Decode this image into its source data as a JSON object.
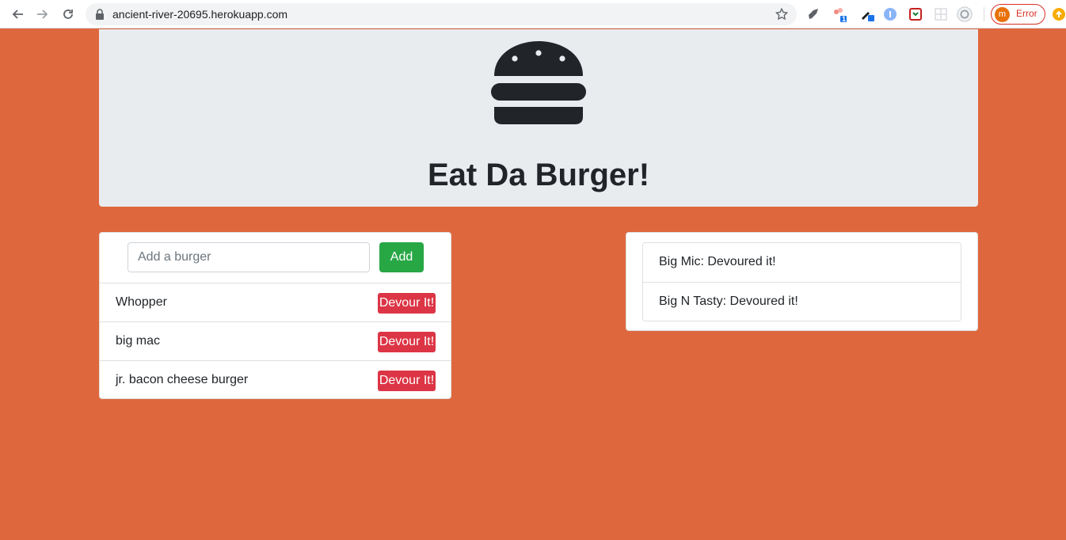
{
  "browser": {
    "url": "ancient-river-20695.herokuapp.com",
    "profile_initial": "m",
    "profile_status": "Error",
    "extension_badge": "1"
  },
  "header": {
    "title": "Eat Da Burger!",
    "icon": "hamburger-icon"
  },
  "add_form": {
    "placeholder": "Add a burger",
    "value": "",
    "add_label": "Add"
  },
  "uneaten": [
    {
      "name": "Whopper",
      "button_label": "Devour It!"
    },
    {
      "name": "big mac",
      "button_label": "Devour It!"
    },
    {
      "name": "jr. bacon cheese burger",
      "button_label": "Devour It!"
    }
  ],
  "devoured": [
    {
      "label": "Big Mic: Devoured it!"
    },
    {
      "label": "Big N Tasty: Devoured it!"
    }
  ],
  "colors": {
    "background": "#df673e",
    "jumbotron": "#e9ecef",
    "add_button": "#28a745",
    "devour_button": "#dc3545"
  }
}
